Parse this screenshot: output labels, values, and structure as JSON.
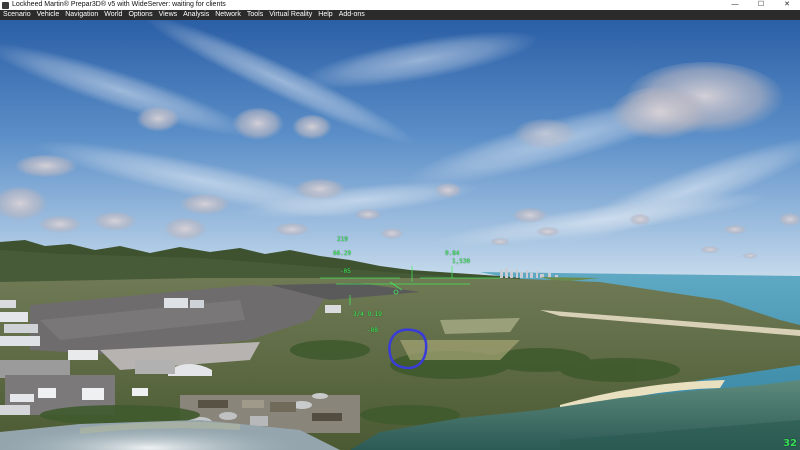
{
  "window": {
    "title": "Lockheed Martin® Prepar3D® v5 with WideServer: waiting for clients",
    "controls": {
      "minimize_glyph": "—",
      "maximize_glyph": "☐",
      "close_glyph": "✕"
    }
  },
  "menu": {
    "items": [
      "Scenario",
      "Vehicle",
      "Navigation",
      "World",
      "Options",
      "Views",
      "Analysis",
      "Network",
      "Tools",
      "Virtual Reality",
      "Help",
      "Add-ons"
    ]
  },
  "hud": {
    "airspeed": "219",
    "heading_left": "66.29",
    "heading_right": "9.84",
    "altitude": "1,530",
    "readout_small": "-05",
    "readout_lower": "3/4 9.19",
    "ladder_low": "-08",
    "color": "#3ef05a"
  },
  "scene": {
    "sky_top": "#2b5fa6",
    "sky_horizon": "#b9d1e8",
    "sea_color": "#6fb7cc",
    "lagoon_color": "#4f7a72",
    "marker_circle_color": "#3a3cd8"
  },
  "status": {
    "frame_rate": "32"
  }
}
